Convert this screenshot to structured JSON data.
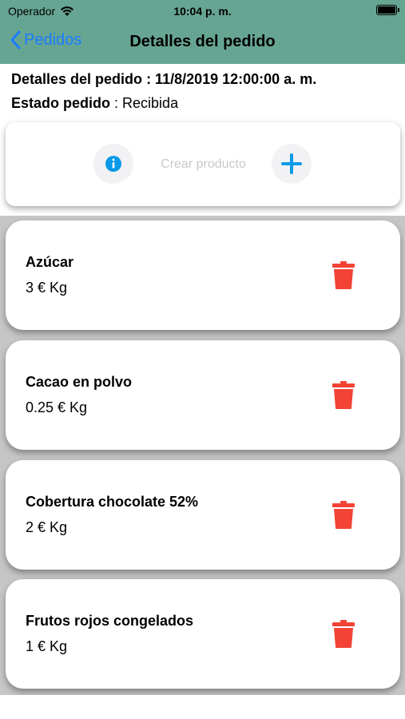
{
  "status_bar": {
    "carrier": "Operador",
    "time": "10:04 p. m."
  },
  "nav": {
    "back_label": "Pedidos",
    "title": "Detalles del pedido"
  },
  "order": {
    "details_label": "Detalles del pedido",
    "details_value": ": 11/8/2019 12:00:00 a. m.",
    "status_label": "Estado pedido",
    "status_value": ": Recibida"
  },
  "create": {
    "placeholder": "Crear producto"
  },
  "colors": {
    "nav_bg": "#67a593",
    "link_blue": "#1a7cff",
    "icon_blue": "#0a9ae8",
    "trash_red": "#f24336",
    "list_bg": "#c6c6c6"
  },
  "products": [
    {
      "name": "Azúcar",
      "price": "3 € Kg"
    },
    {
      "name": "Cacao en polvo",
      "price": "0.25 € Kg"
    },
    {
      "name": "Cobertura chocolate 52%",
      "price": "2 € Kg"
    },
    {
      "name": "Frutos rojos congelados",
      "price": "1 € Kg"
    }
  ]
}
